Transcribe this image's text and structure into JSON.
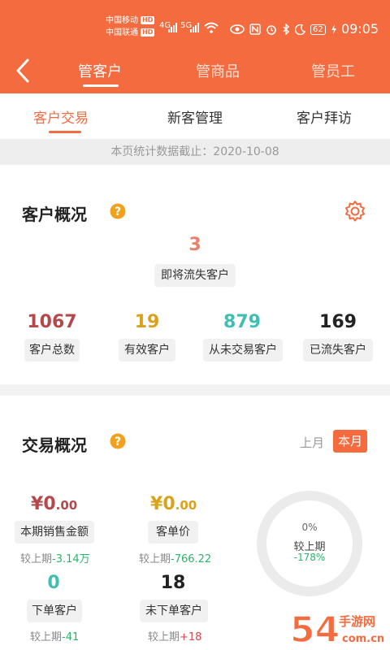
{
  "status_bar": {
    "carrier1": "中国移动",
    "carrier2": "中国联通",
    "hd": "HD",
    "net1": "4G",
    "net2": "5G",
    "battery": "62",
    "time": "09:05"
  },
  "header": {
    "tabs": [
      {
        "label": "管客户"
      },
      {
        "label": "管商品"
      },
      {
        "label": "管员工"
      }
    ]
  },
  "subtabs": [
    {
      "label": "客户交易"
    },
    {
      "label": "新客管理"
    },
    {
      "label": "客户拜访"
    }
  ],
  "stat_date": "本页统计数据截止：2020-10-08",
  "overview": {
    "title": "客户概况",
    "losing": {
      "value": "3",
      "label": "即将流失客户"
    },
    "stats": [
      {
        "value": "1067",
        "label": "客户总数",
        "color": "#b5484a"
      },
      {
        "value": "19",
        "label": "有效客户",
        "color": "#d9a21b"
      },
      {
        "value": "879",
        "label": "从未交易客户",
        "color": "#3fbfb2"
      },
      {
        "value": "169",
        "label": "已流失客户",
        "color": "#222222"
      }
    ]
  },
  "trade": {
    "title": "交易概况",
    "period_last": "上月",
    "period_current": "本月",
    "sales": {
      "yen": "¥",
      "int": "0",
      "dec": ".00",
      "label": "本期销售金额",
      "cmp_prefix": "较上期",
      "cmp_value": "-3.14万",
      "color": "#b5484a"
    },
    "unit_price": {
      "yen": "¥",
      "int": "0",
      "dec": ".00",
      "label": "客单价",
      "cmp_prefix": "较上期",
      "cmp_value": "-766.22",
      "color": "#d9a21b"
    },
    "ordered": {
      "value": "0",
      "label": "下单客户",
      "cmp_prefix": "较上期",
      "cmp_value": "-41",
      "color": "#3fbfb2"
    },
    "not_ordered": {
      "value": "18",
      "label": "未下单客户",
      "cmp_prefix": "较上期",
      "cmp_value": "+18",
      "color": "#222222"
    },
    "ring": {
      "percent": "0%",
      "label": "较上期",
      "delta": "-178%",
      "fill": 0
    }
  },
  "watermark": {
    "text1": "54",
    "text2": "手游网",
    "text3": "com.cn"
  },
  "colors": {
    "accent": "#f36b3f"
  }
}
